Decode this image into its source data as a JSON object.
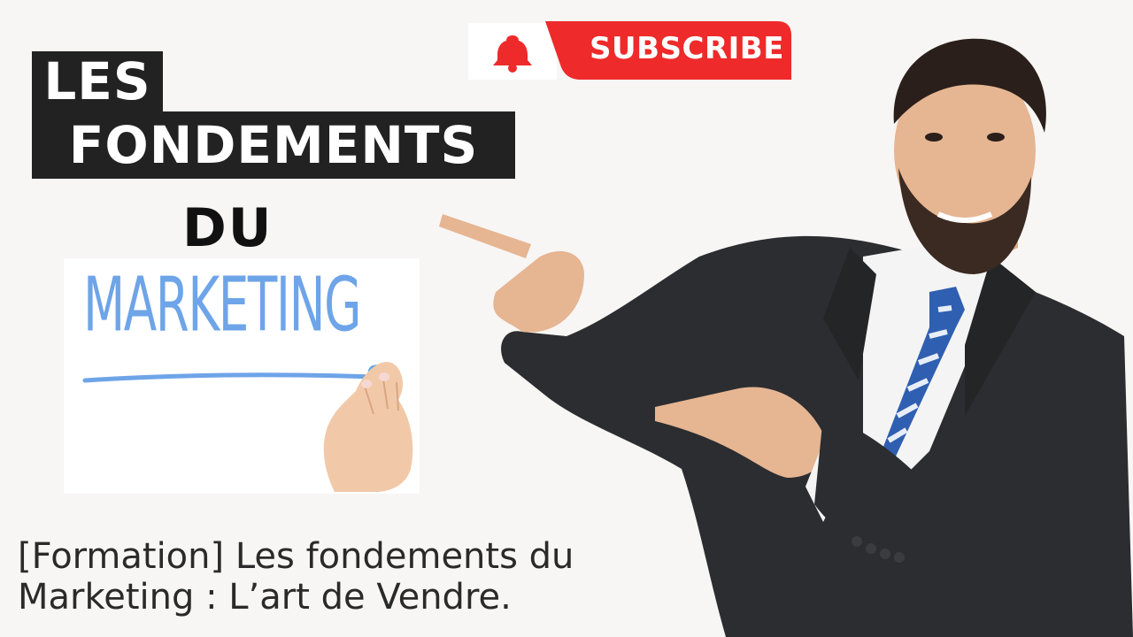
{
  "title": {
    "line1": "LES",
    "line2": "FONDEMENTS",
    "line3": "DU"
  },
  "marketing_word": "MARKETING",
  "subscribe": {
    "label": "SUBSCRIBE",
    "icon": "bell-icon",
    "color": "#ee2a2a"
  },
  "caption": {
    "line1": "[Formation] Les fondements du",
    "line2": "Marketing : L’art de Vendre."
  },
  "colors": {
    "title_bg": "#222222",
    "marketing_blue": "#6ea4e8",
    "background": "#f7f6f4"
  }
}
